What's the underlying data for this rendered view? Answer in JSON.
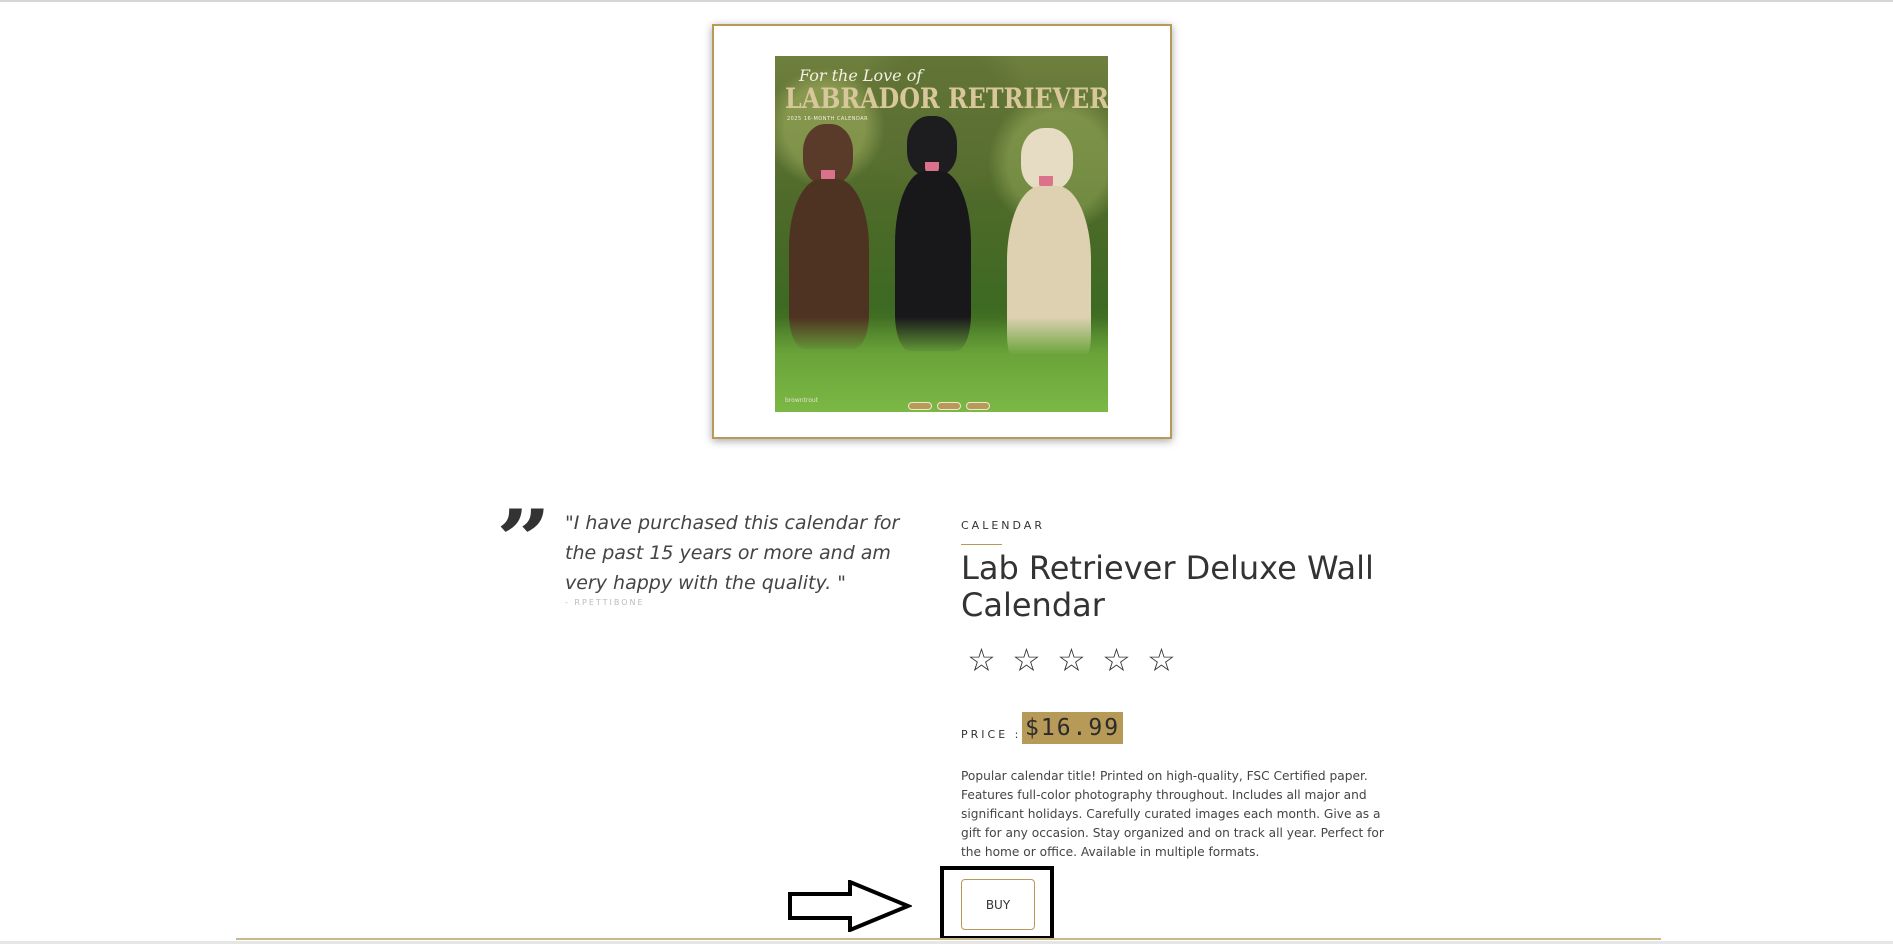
{
  "product_image": {
    "cover_script": "For the Love of",
    "cover_title": "LABRADOR RETRIEVERS",
    "cover_subtitle": "2025 16-MONTH CALENDAR",
    "brand_mark": "browntrout",
    "slides": 3
  },
  "testimonial": {
    "text": "\"I have purchased this calendar for the past 15 years or more and am very happy with the quality. \"",
    "author": "- RPETTIBONE"
  },
  "product": {
    "category": "CALENDAR",
    "title": "Lab Retriever Deluxe Wall Calendar",
    "rating": {
      "value": 0,
      "max": 5
    },
    "price_label": "PRICE :",
    "price": "$16.99",
    "description": "Popular calendar title! Printed on high-quality, FSC Certified paper. Features full-color photography throughout. Includes all major and significant holidays. Carefully curated images each month. Give as a gift for any occasion. Stay organized and on track all year. Perfect for the home or office. Available in multiple formats.",
    "buy_label": "BUY"
  },
  "colors": {
    "accent": "#b79a57",
    "text": "#333333",
    "highlight_box": "#000000"
  },
  "icons": {
    "quote": "quote-icon",
    "star": "star-outline-icon",
    "arrow": "arrow-right-icon"
  }
}
